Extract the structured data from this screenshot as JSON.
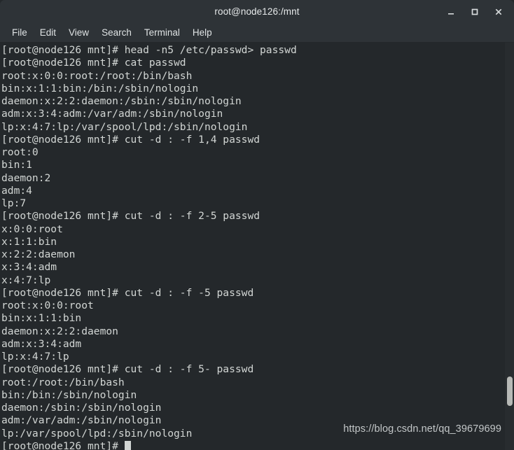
{
  "window": {
    "title": "root@node126:/mnt",
    "controls": [
      {
        "name": "minimize",
        "glyph": "_"
      },
      {
        "name": "maximize",
        "glyph": "□"
      },
      {
        "name": "close",
        "glyph": "×"
      }
    ],
    "colors": {
      "titlebar_bg": "#2e3337",
      "menubar_bg": "#2e3337",
      "terminal_bg": "#24282b",
      "terminal_fg": "#d2d6d4",
      "scrollbar_track": "#282c2f",
      "scrollbar_thumb": "#b7b9b6"
    }
  },
  "menubar": {
    "items": [
      {
        "label": "File"
      },
      {
        "label": "Edit"
      },
      {
        "label": "View"
      },
      {
        "label": "Search"
      },
      {
        "label": "Terminal"
      },
      {
        "label": "Help"
      }
    ]
  },
  "terminal": {
    "prompt": "[root@node126 mnt]#",
    "lines": [
      "[root@node126 mnt]# head -n5 /etc/passwd> passwd",
      "[root@node126 mnt]# cat passwd",
      "root:x:0:0:root:/root:/bin/bash",
      "bin:x:1:1:bin:/bin:/sbin/nologin",
      "daemon:x:2:2:daemon:/sbin:/sbin/nologin",
      "adm:x:3:4:adm:/var/adm:/sbin/nologin",
      "lp:x:4:7:lp:/var/spool/lpd:/sbin/nologin",
      "[root@node126 mnt]# cut -d : -f 1,4 passwd",
      "root:0",
      "bin:1",
      "daemon:2",
      "adm:4",
      "lp:7",
      "[root@node126 mnt]# cut -d : -f 2-5 passwd",
      "x:0:0:root",
      "x:1:1:bin",
      "x:2:2:daemon",
      "x:3:4:adm",
      "x:4:7:lp",
      "[root@node126 mnt]# cut -d : -f -5 passwd",
      "root:x:0:0:root",
      "bin:x:1:1:bin",
      "daemon:x:2:2:daemon",
      "adm:x:3:4:adm",
      "lp:x:4:7:lp",
      "[root@node126 mnt]# cut -d : -f 5- passwd",
      "root:/root:/bin/bash",
      "bin:/bin:/sbin/nologin",
      "daemon:/sbin:/sbin/nologin",
      "adm:/var/adm:/sbin/nologin",
      "lp:/var/spool/lpd:/sbin/nologin"
    ],
    "last_prompt": "[root@node126 mnt]# "
  },
  "watermark": {
    "text": "https://blog.csdn.net/qq_39679699"
  }
}
